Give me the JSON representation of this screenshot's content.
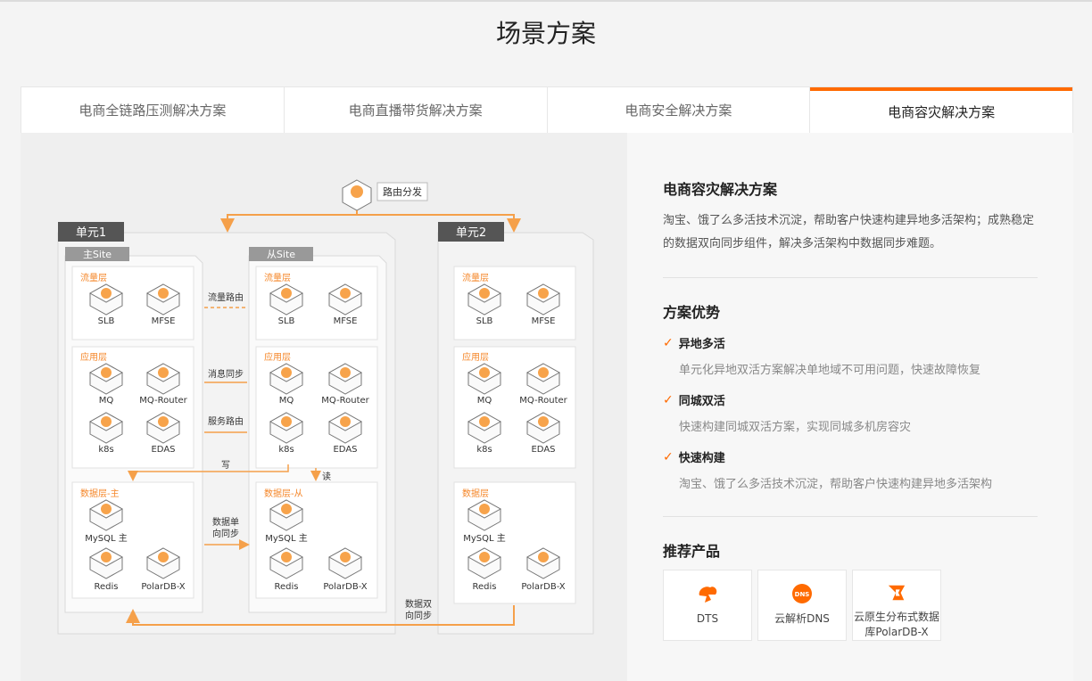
{
  "page": {
    "title": "场景方案"
  },
  "tabs": [
    {
      "label": "电商全链路压测解决方案"
    },
    {
      "label": "电商直播带货解决方案"
    },
    {
      "label": "电商安全解决方案"
    },
    {
      "label": "电商容灾解决方案"
    }
  ],
  "active_tab": 3,
  "solution": {
    "title": "电商容灾解决方案",
    "description": "淘宝、饿了么多活技术沉淀，帮助客户快速构建异地多活架构；成熟稳定的数据双向同步组件，解决多活架构中数据同步难题。",
    "advantages_title": "方案优势",
    "advantages": [
      {
        "title": "异地多活",
        "desc": "单元化异地双活方案解决单地域不可用问题，快速故障恢复"
      },
      {
        "title": "同城双活",
        "desc": "快速构建同城双活方案，实现同城多机房容灾"
      },
      {
        "title": "快速构建",
        "desc": "淘宝、饿了么多活技术沉淀，帮助客户快速构建异地多活架构"
      }
    ],
    "products_title": "推荐产品",
    "products": [
      {
        "name": "DTS",
        "icon": "dts-icon"
      },
      {
        "name": "云解析DNS",
        "icon": "dns-icon"
      },
      {
        "name": "云原生分布式数据库PolarDB-X",
        "icon": "polardb-icon"
      }
    ]
  },
  "diagram": {
    "route_label": "路由分发",
    "unit1": "单元1",
    "unit2": "单元2",
    "main_site": "主Site",
    "slave_site": "从Site",
    "traffic_layer": "流量层",
    "app_layer": "应用层",
    "data_layer": "数据层",
    "data_layer_main": "数据层-主",
    "data_layer_slave": "数据层-从",
    "slb": "SLB",
    "mfse": "MFSE",
    "mq": "MQ",
    "mq_router": "MQ-Router",
    "k8s": "k8s",
    "edas": "EDAS",
    "mysql_main": "MySQL 主",
    "redis": "Redis",
    "polardb": "PolarDB-X",
    "traffic_route": "流量路由",
    "msg_sync": "消息同步",
    "service_route": "服务路由",
    "write": "写",
    "read": "读",
    "data_oneway_1": "数据单",
    "data_oneway_2": "向同步",
    "data_twoway_1": "数据双",
    "data_twoway_2": "向同步"
  }
}
